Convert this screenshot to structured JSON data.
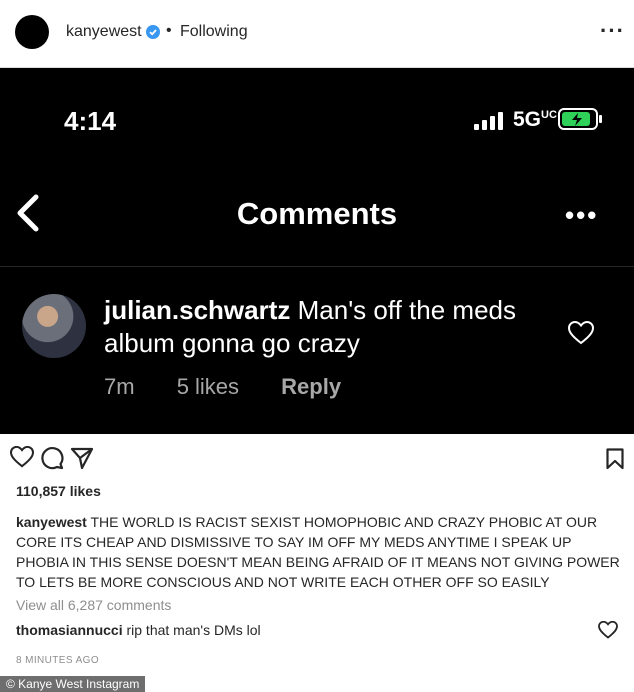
{
  "header": {
    "username": "kanyewest",
    "separator": "•",
    "follow_status": "Following",
    "more": "···"
  },
  "screenshot": {
    "time": "4:14",
    "network": "5G",
    "network_sub": "UC",
    "title": "Comments",
    "more": "•••",
    "comment": {
      "username": "julian.schwartz",
      "text": "Man's off the meds album gonna go crazy",
      "age": "7m",
      "likes": "5 likes",
      "reply": "Reply"
    }
  },
  "post": {
    "likes": "110,857 likes",
    "caption_user": "kanyewest",
    "caption_text": "THE WORLD IS RACIST SEXIST HOMOPHOBIC AND CRAZY PHOBIC AT OUR CORE ITS CHEAP AND DISMISSIVE TO SAY IM OFF MY MEDS ANYTIME I SPEAK UP PHOBIA IN THIS SENSE DOESN'T MEAN BEING AFRAID OF IT MEANS NOT GIVING POWER TO LETS BE MORE CONSCIOUS AND NOT WRITE EACH OTHER OFF SO EASILY",
    "view_all": "View all 6,287 comments",
    "comment_user": "thomasiannucci",
    "comment_text": "rip that man's DMs lol",
    "time_ago": "8 MINUTES AGO"
  },
  "credit": "© Kanye West Instagram",
  "icons": [
    "verified-icon",
    "more-icon",
    "back-icon",
    "heart-icon",
    "comment-icon",
    "share-icon",
    "bookmark-icon",
    "signal-icon",
    "battery-icon"
  ],
  "colors": {
    "verified": "#3897f0",
    "battery": "#30d158",
    "muted": "#8e8e8e"
  }
}
